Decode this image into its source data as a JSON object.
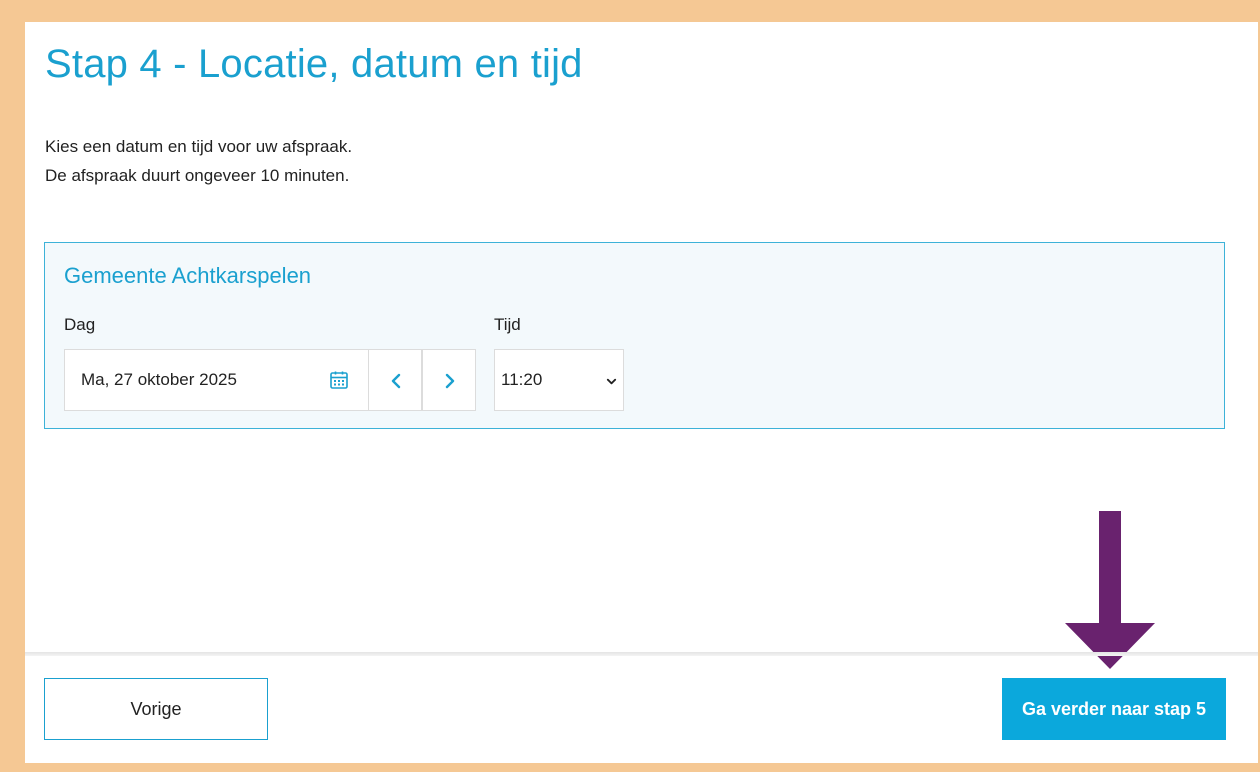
{
  "title": "Stap 4 - Locatie, datum en tijd",
  "intro": {
    "line1": "Kies een datum en tijd voor uw afspraak.",
    "line2": "De afspraak duurt ongeveer 10 minuten."
  },
  "location": {
    "name": "Gemeente Achtkarspelen",
    "day_label": "Dag",
    "time_label": "Tijd",
    "selected_date": "Ma, 27 oktober 2025",
    "selected_time": "11:20"
  },
  "footer": {
    "previous_label": "Vorige",
    "next_label": "Ga verder naar stap 5"
  },
  "icons": {
    "calendar": "calendar-icon",
    "previous_day": "chevron-left-icon",
    "next_day": "chevron-right-icon",
    "time_dropdown": "chevron-down-icon",
    "annotation": "arrow-down-icon"
  },
  "colors": {
    "accent": "#1aa0cf",
    "primary_button": "#0ba8dc",
    "panel_background": "#f3f9fc",
    "frame": "#f5c894",
    "annotation_arrow": "#69226e"
  }
}
